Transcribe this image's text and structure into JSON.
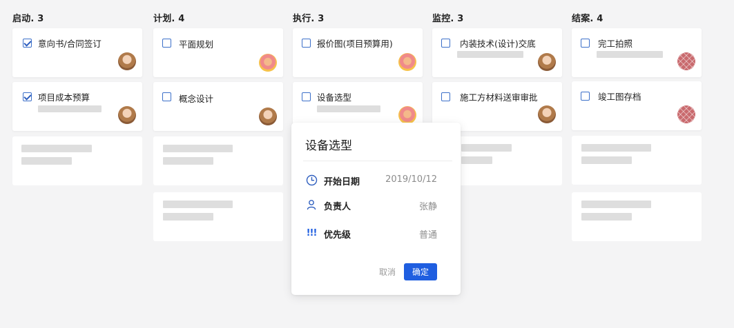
{
  "columns": [
    {
      "title": "启动. 3",
      "cards": [
        {
          "label": "意向书/合同签订",
          "checked": true,
          "avatar": "blonde"
        },
        {
          "label": "项目成本预算",
          "checked": true,
          "avatar": "blonde"
        }
      ]
    },
    {
      "title": "计划. 4",
      "cards": [
        {
          "label": "平面规划",
          "checked": false,
          "avatar": "sun"
        },
        {
          "label": "概念设计",
          "checked": false,
          "avatar": "blonde"
        }
      ]
    },
    {
      "title": "执行. 3",
      "cards": [
        {
          "label": "报价图(项目预算用)",
          "checked": false,
          "avatar": "sun"
        },
        {
          "label": "设备选型",
          "checked": false,
          "avatar": "sun"
        }
      ]
    },
    {
      "title": "监控. 3",
      "cards": [
        {
          "label": "内装技术(设计)交底",
          "checked": false,
          "avatar": "blonde"
        },
        {
          "label": "施工方材料送审审批",
          "checked": false,
          "avatar": "blonde"
        }
      ]
    },
    {
      "title": "结案. 4",
      "cards": [
        {
          "label": "完工拍照",
          "checked": false,
          "avatar": "pattern"
        },
        {
          "label": "竣工图存档",
          "checked": false,
          "avatar": "pattern"
        }
      ]
    }
  ],
  "popup": {
    "title": "设备选型",
    "rows": [
      {
        "icon": "clock-icon",
        "label": "开始日期",
        "value": "2019/10/12"
      },
      {
        "icon": "user-icon",
        "label": "负责人",
        "value": "张静"
      },
      {
        "icon": "priority-icon",
        "label": "优先级",
        "value": "普通",
        "glyph": "!!!"
      }
    ],
    "cancel_label": "取消",
    "ok_label": "确定"
  },
  "colors": {
    "accent": "#1f5ee0",
    "checkbox": "#3b6fc9",
    "background": "#f4f4f5",
    "skeleton": "#dedede"
  }
}
